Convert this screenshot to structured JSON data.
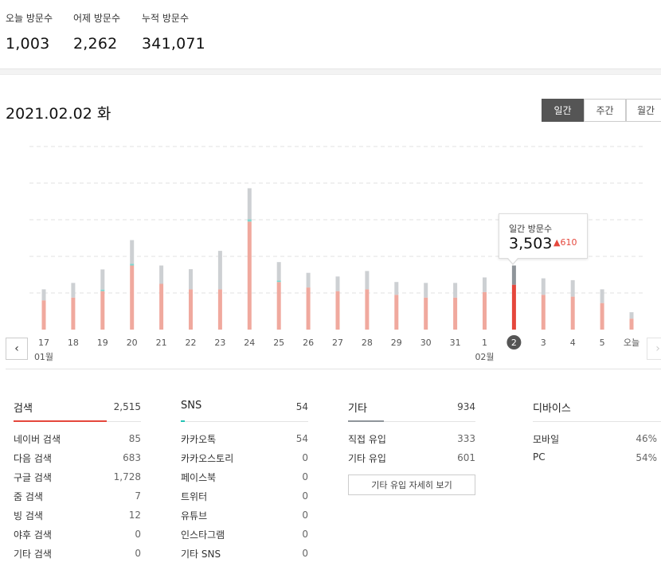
{
  "summary": {
    "today": {
      "label": "오늘 방문수",
      "value": "1,003"
    },
    "yesterday": {
      "label": "어제 방문수",
      "value": "2,262"
    },
    "total": {
      "label": "누적 방문수",
      "value": "341,071"
    }
  },
  "date_title": "2021.02.02 화",
  "period_tabs": [
    {
      "label": "일간",
      "active": true
    },
    {
      "label": "주간",
      "active": false
    },
    {
      "label": "월간",
      "active": false
    }
  ],
  "nav": {
    "prev": "‹",
    "next": "›"
  },
  "tooltip": {
    "label": "일간 방문수",
    "value": "3,503",
    "delta": "610"
  },
  "colors": {
    "bar_main": "#f0a99e",
    "bar_top": "#cdd0d3",
    "bar_accent": "#7fd6cf",
    "bar_selected_main": "#e5473c",
    "bar_selected_top": "#8f959a",
    "search_bar": "#e5473c",
    "sns_bar": "#23c2b4",
    "other_bar": "#8f959a"
  },
  "chart_data": {
    "type": "bar",
    "categories": [
      "17",
      "18",
      "19",
      "20",
      "21",
      "22",
      "23",
      "24",
      "25",
      "26",
      "27",
      "28",
      "29",
      "30",
      "31",
      "1",
      "2",
      "3",
      "4",
      "5",
      "오늘"
    ],
    "month_labels": [
      {
        "index": 0,
        "label": "01월"
      },
      {
        "index": 15,
        "label": "02월"
      }
    ],
    "selected_index": 16,
    "series": [
      {
        "name": "검색",
        "values": [
          1600,
          1750,
          2100,
          3500,
          2500,
          2200,
          2200,
          5900,
          2600,
          2300,
          2100,
          2200,
          1900,
          1750,
          1750,
          2050,
          2450,
          1900,
          1800,
          1450,
          600
        ]
      },
      {
        "name": "SNS",
        "values": [
          0,
          0,
          60,
          80,
          0,
          0,
          0,
          120,
          70,
          0,
          0,
          0,
          0,
          0,
          0,
          0,
          0,
          0,
          0,
          0,
          0
        ]
      },
      {
        "name": "기타",
        "values": [
          600,
          800,
          1100,
          1300,
          1000,
          1100,
          2100,
          1700,
          1000,
          800,
          800,
          1000,
          700,
          800,
          800,
          800,
          1050,
          900,
          900,
          750,
          350
        ]
      }
    ],
    "ylim": [
      0,
      10000
    ],
    "grid": true
  },
  "panels": {
    "search": {
      "title": "검색",
      "total": "2,515",
      "rows": [
        {
          "label": "네이버 검색",
          "value": "85"
        },
        {
          "label": "다음 검색",
          "value": "683"
        },
        {
          "label": "구글 검색",
          "value": "1,728"
        },
        {
          "label": "줌 검색",
          "value": "7"
        },
        {
          "label": "빙 검색",
          "value": "12"
        },
        {
          "label": "야후 검색",
          "value": "0"
        },
        {
          "label": "기타 검색",
          "value": "0"
        }
      ]
    },
    "sns": {
      "title": "SNS",
      "total": "54",
      "rows": [
        {
          "label": "카카오톡",
          "value": "54"
        },
        {
          "label": "카카오스토리",
          "value": "0"
        },
        {
          "label": "페이스북",
          "value": "0"
        },
        {
          "label": "트위터",
          "value": "0"
        },
        {
          "label": "유튜브",
          "value": "0"
        },
        {
          "label": "인스타그램",
          "value": "0"
        },
        {
          "label": "기타 SNS",
          "value": "0"
        }
      ]
    },
    "other": {
      "title": "기타",
      "total": "934",
      "rows": [
        {
          "label": "직접 유입",
          "value": "333"
        },
        {
          "label": "기타 유입",
          "value": "601"
        }
      ],
      "button": "기타 유입 자세히 보기"
    },
    "device": {
      "title": "디바이스",
      "rows": [
        {
          "label": "모바일",
          "value": "46%"
        },
        {
          "label": "PC",
          "value": "54%"
        }
      ]
    }
  }
}
